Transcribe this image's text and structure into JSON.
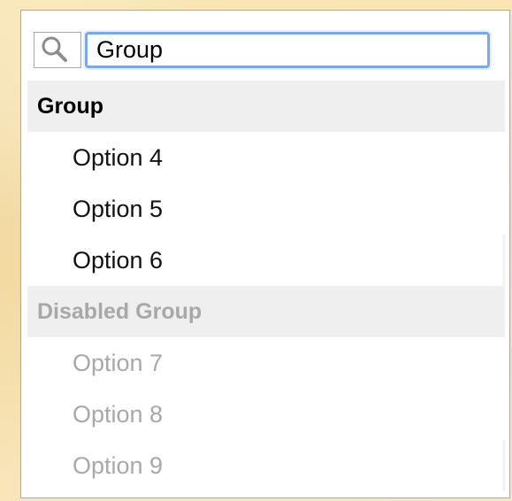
{
  "search": {
    "value": "Group"
  },
  "groups": [
    {
      "label": "Group",
      "options": [
        "Option 4",
        "Option 5",
        "Option 6"
      ]
    },
    {
      "label": "Disabled Group",
      "options": [
        "Option 7",
        "Option 8",
        "Option 9"
      ]
    }
  ],
  "colors": {
    "accent": "#78a9ea",
    "group_background": "#efefef",
    "disabled_text": "#a8a8a8",
    "border": "#a9a9a9"
  },
  "icons": {
    "search": "search-icon"
  }
}
